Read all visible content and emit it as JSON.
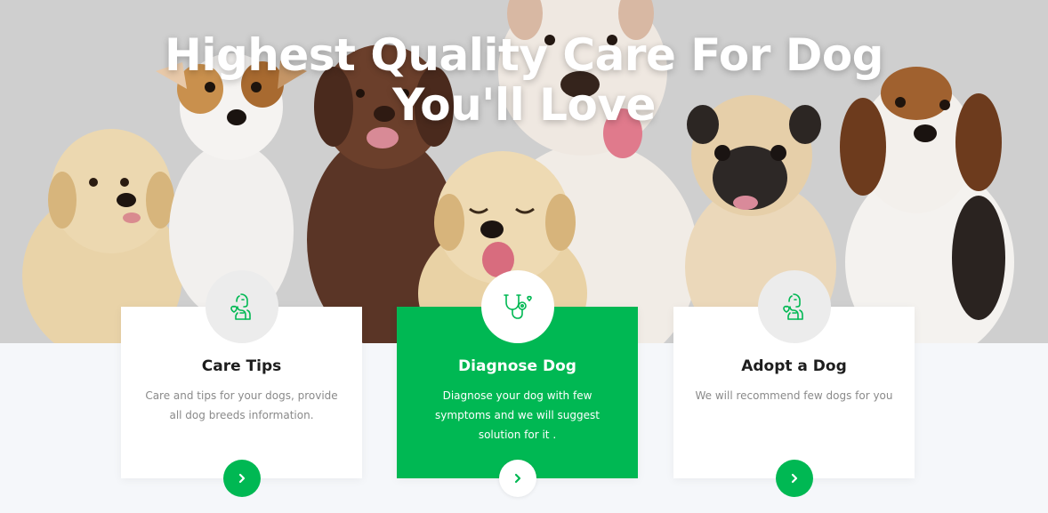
{
  "hero": {
    "title_line1": "Highest Quality Care For Dog",
    "title_line2": "You'll Love"
  },
  "cards": [
    {
      "title": "Care Tips",
      "description": "Care and tips for your dogs, provide all dog breeds information.",
      "icon": "dog-care-icon",
      "active": false
    },
    {
      "title": "Diagnose Dog",
      "description": "Diagnose your dog with few symptoms and we will suggest solution for it .",
      "icon": "stethoscope-icon",
      "active": true
    },
    {
      "title": "Adopt a Dog",
      "description": "We will recommend few dogs for you",
      "icon": "dog-adopt-icon",
      "active": false
    }
  ],
  "colors": {
    "accent": "#00b853",
    "hero_background": "#cfcfcf",
    "section_background": "#f5f7fa"
  }
}
